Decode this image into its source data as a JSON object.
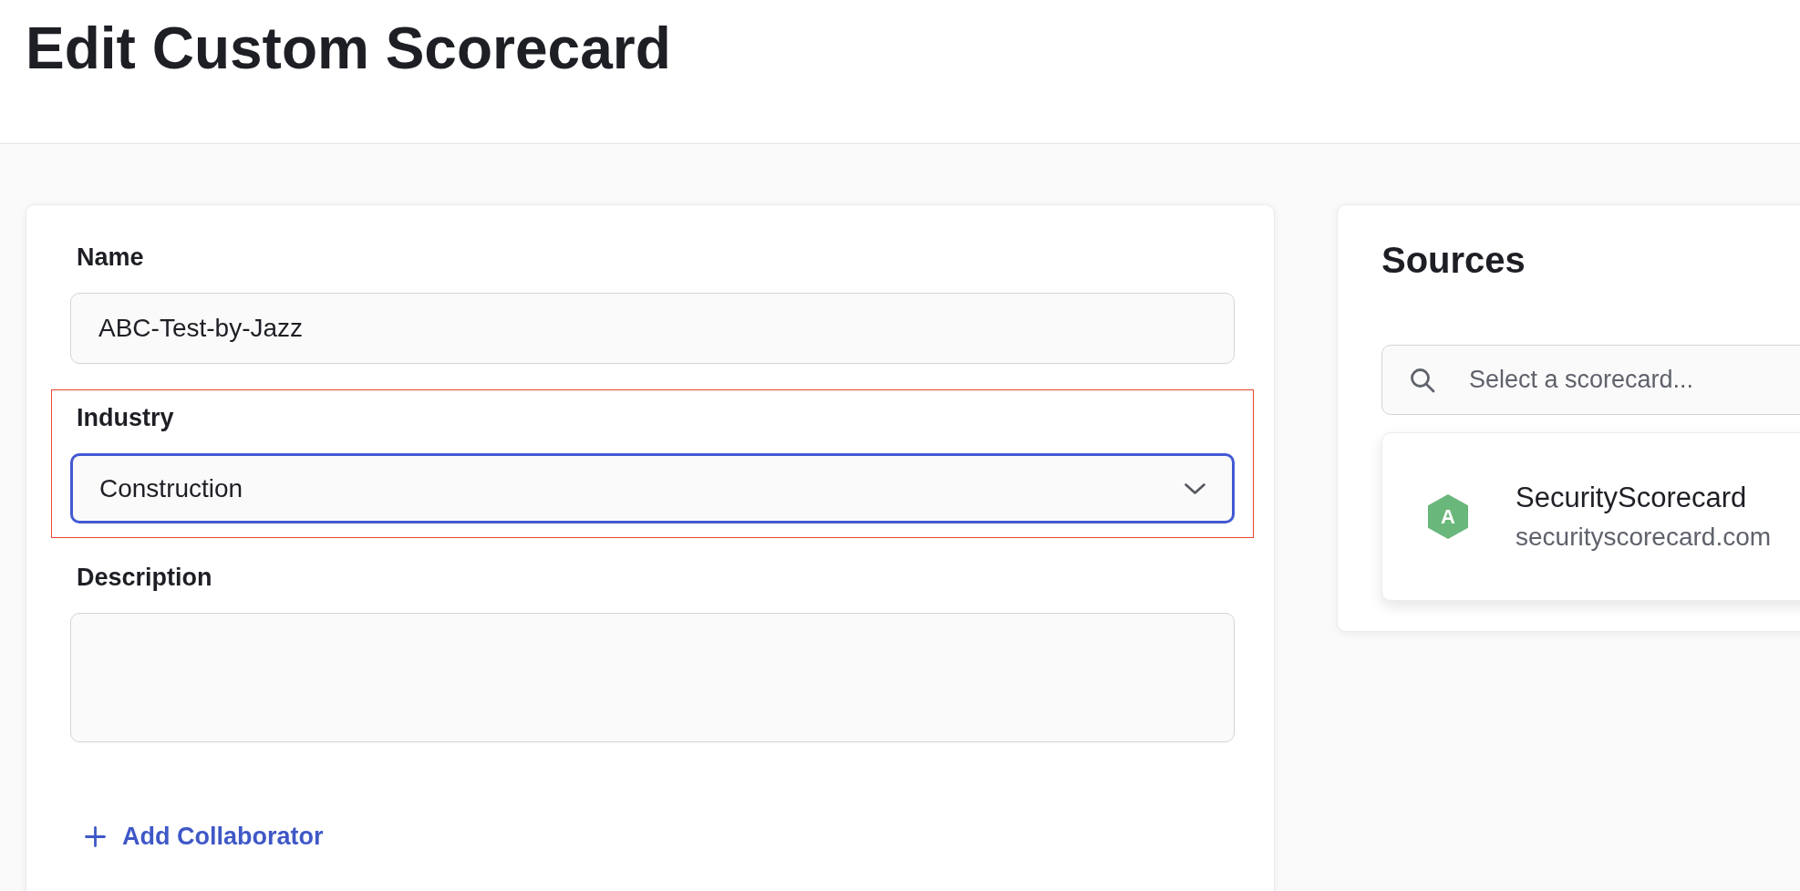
{
  "page": {
    "title": "Edit Custom Scorecard"
  },
  "form": {
    "fields": [
      {
        "kind": "text",
        "label": "Name",
        "value": "ABC-Test-by-Jazz",
        "focused": false,
        "highlighted": false
      },
      {
        "kind": "select",
        "label": "Industry",
        "value": "Construction",
        "focused": true,
        "highlighted": true
      },
      {
        "kind": "textarea",
        "label": "Description",
        "focused": false,
        "highlighted": false
      }
    ],
    "add_button": {
      "label": "Add Collaborator"
    }
  },
  "sources": {
    "title": "Sources",
    "search": {
      "placeholder": "Select a scorecard..."
    },
    "items": [
      {
        "grade": "A",
        "color": "#6ab77b",
        "name": "SecurityScorecard",
        "domain": "securityscorecard.com"
      }
    ]
  }
}
